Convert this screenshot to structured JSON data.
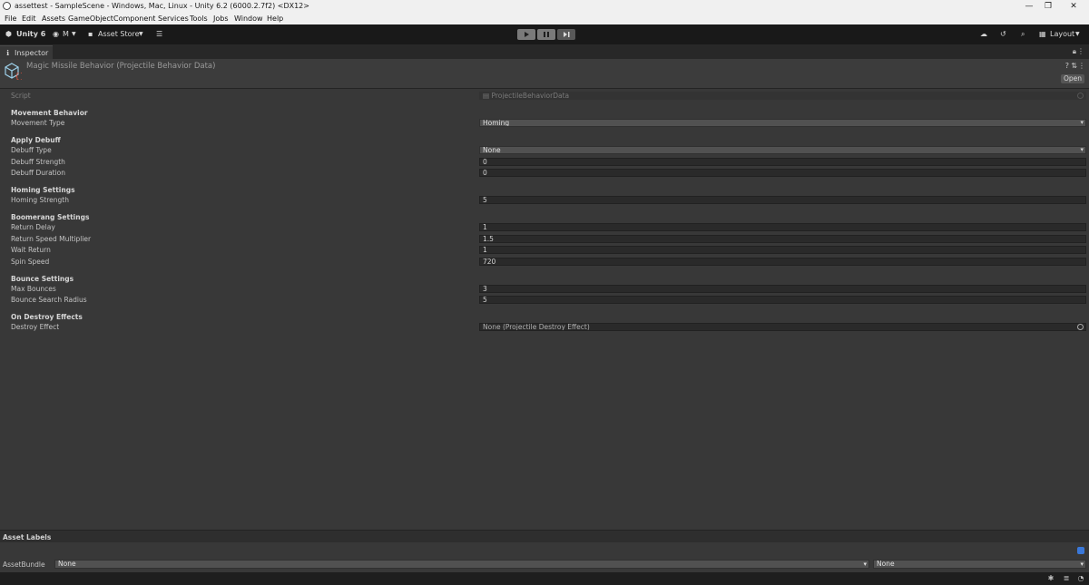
{
  "window": {
    "title": "assettest - SampleScene - Windows, Mac, Linux - Unity 6.2 (6000.2.7f2) <DX12>",
    "minimize": "—",
    "maximize": "❐",
    "close": "✕"
  },
  "menu": [
    "File",
    "Edit",
    "Assets",
    "GameObject",
    "Component",
    "Services",
    "Tools",
    "Jobs",
    "Window",
    "Help"
  ],
  "toolbar": {
    "unity_label": "Unity 6",
    "account_label": "M",
    "asset_store_label": "Asset Store",
    "layout_label": "Layout"
  },
  "inspector": {
    "tab_label": "Inspector",
    "object_title": "Magic Missile Behavior (Projectile Behavior Data)",
    "open_button": "Open",
    "script_label": "Script",
    "script_value": "ProjectileBehaviorData"
  },
  "sections": {
    "movement": {
      "header": "Movement Behavior",
      "type_label": "Movement Type",
      "type_value": "Homing"
    },
    "debuff": {
      "header": "Apply Debuff",
      "type_label": "Debuff Type",
      "type_value": "None",
      "strength_label": "Debuff Strength",
      "strength_value": "0",
      "duration_label": "Debuff Duration",
      "duration_value": "0"
    },
    "homing": {
      "header": "Homing Settings",
      "strength_label": "Homing Strength",
      "strength_value": "5"
    },
    "boomerang": {
      "header": "Boomerang Settings",
      "return_delay_label": "Return Delay",
      "return_delay_value": "1",
      "return_speed_label": "Return Speed Multiplier",
      "return_speed_value": "1.5",
      "wait_return_label": "Wait Return",
      "wait_return_value": "1",
      "spin_speed_label": "Spin Speed",
      "spin_speed_value": "720"
    },
    "bounce": {
      "header": "Bounce Settings",
      "max_bounces_label": "Max Bounces",
      "max_bounces_value": "3",
      "radius_label": "Bounce Search Radius",
      "radius_value": "5"
    },
    "destroy": {
      "header": "On Destroy Effects",
      "effect_label": "Destroy Effect",
      "effect_value": "None (Projectile Destroy Effect)"
    }
  },
  "footer": {
    "asset_labels": "Asset Labels",
    "asset_bundle_label": "AssetBundle",
    "asset_bundle_value": "None",
    "asset_variant_value": "None"
  },
  "colors": {
    "background": "#383838",
    "toolbar": "#191919",
    "field": "#2a2a2a",
    "dropdown": "#515151",
    "accent": "#3a78d9"
  }
}
